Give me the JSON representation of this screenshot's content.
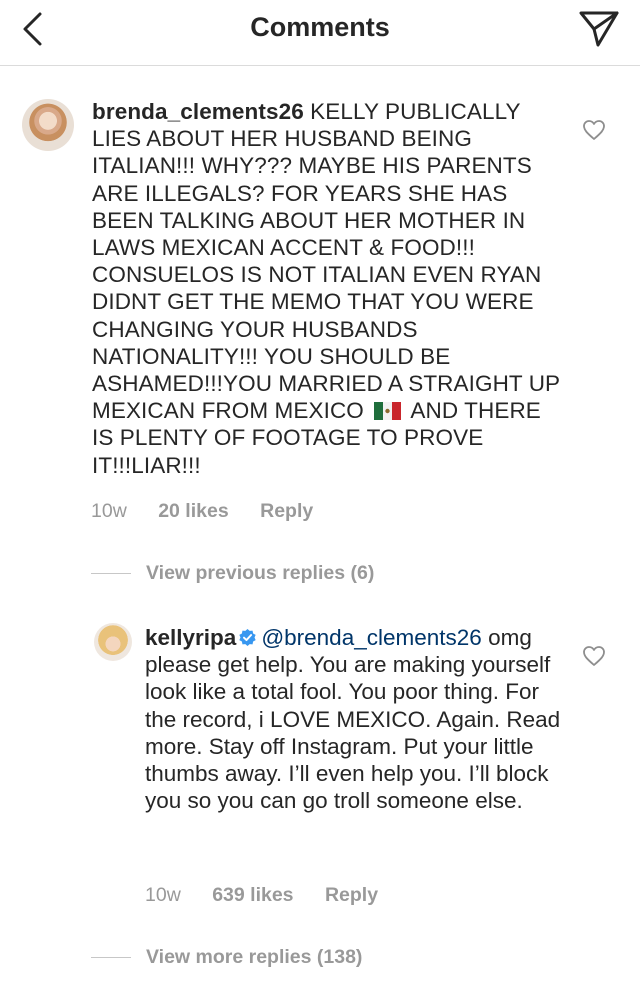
{
  "header": {
    "title": "Comments",
    "back_icon": "chevron-left-icon",
    "send_icon": "paper-plane-icon"
  },
  "comments": [
    {
      "username": "brenda_clements26",
      "text_part1": "KELLY PUBLICALLY LIES ABOUT HER HUSBAND BEING ITALIAN!!! WHY??? MAYBE HIS PARENTS ARE ILLEGALS?  FOR YEARS SHE HAS BEEN TALKING ABOUT HER MOTHER IN LAWS MEXICAN ACCENT & FOOD!!! CONSUELOS IS NOT ITALIAN EVEN RYAN DIDNT GET THE MEMO THAT YOU WERE CHANGING YOUR HUSBANDS NATIONALITY!!! YOU SHOULD BE ASHAMED!!!YOU MARRIED A STRAIGHT UP MEXICAN FROM MEXICO",
      "flag_icon": "mexico-flag-icon",
      "text_part2": "AND THERE IS PLENTY OF FOOTAGE TO PROVE IT!!!LIAR!!!",
      "time": "10w",
      "likes": "20 likes",
      "reply": "Reply",
      "view_replies": "View previous replies (6)"
    },
    {
      "username": "kellyripa",
      "verified_icon": "verified-badge-icon",
      "mention": "@brenda_clements26",
      "text": "omg please get help. You are making yourself look like a total fool. You poor thing. For the record, i LOVE MEXICO. Again. Read more. Stay off Instagram. Put your little thumbs away. I’ll even help you. I’ll block you so you can go troll someone else.",
      "time": "10w",
      "likes": "639 likes",
      "reply": "Reply",
      "view_replies": "View more replies (138)"
    }
  ],
  "colors": {
    "text": "#262626",
    "secondary": "#999999",
    "mention": "#003569",
    "verified": "#3897f0",
    "border": "#dbdbdb"
  }
}
